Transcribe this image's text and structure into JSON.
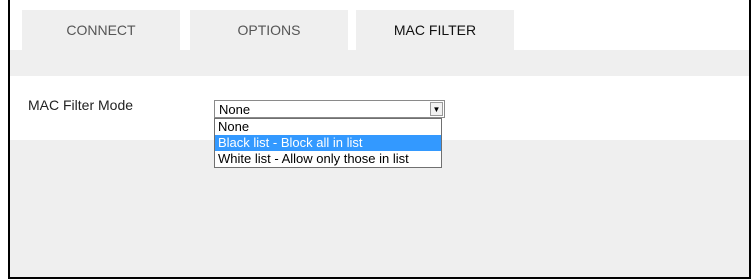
{
  "tabs": [
    {
      "label": "CONNECT",
      "active": false
    },
    {
      "label": "OPTIONS",
      "active": false
    },
    {
      "label": "MAC FILTER",
      "active": true
    }
  ],
  "mac_filter": {
    "mode_label": "MAC Filter Mode",
    "selected_value": "None",
    "arrow_icon": "chevron-down-icon",
    "options": [
      {
        "label": "None",
        "highlighted": false
      },
      {
        "label": "Black list - Block all in list",
        "highlighted": true
      },
      {
        "label": "White list - Allow only those in list",
        "highlighted": false
      }
    ]
  },
  "colors": {
    "highlight": "#3399ff",
    "tab_bg": "#efefef",
    "content_bg": "#efefef"
  }
}
